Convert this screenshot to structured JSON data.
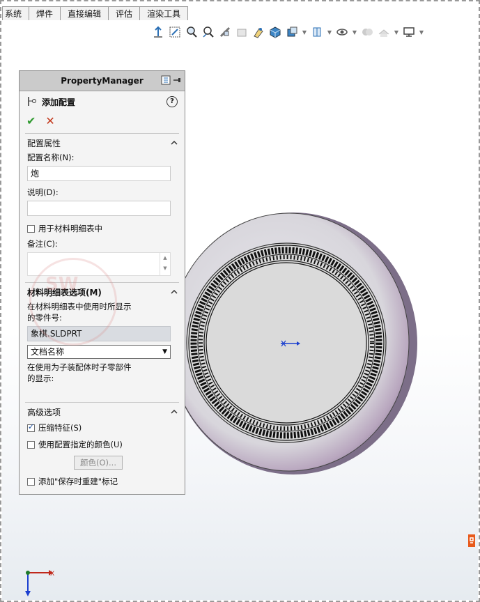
{
  "tabs": [
    "系统",
    "焊件",
    "直接编辑",
    "评估",
    "渲染工具"
  ],
  "hud_icons": [
    "view-orientation-icon",
    "zoom-to-fit-icon",
    "zoom-to-area-icon",
    "previous-view-icon",
    "section-view-icon",
    "dynamic-annotation-icon",
    "view-orientation-cube-icon",
    "display-style-icon",
    "hide-show-items-icon",
    "edit-appearance-icon",
    "apply-scene-icon",
    "view-settings-icon",
    "display-settings-icon"
  ],
  "pm": {
    "header": "PropertyManager",
    "title": "添加配置",
    "help": "?",
    "ok": "✔",
    "cancel": "✕",
    "config_props": {
      "heading": "配置属性",
      "name_label": "配置名称(N):",
      "name_value": "炮",
      "desc_label": "说明(D):",
      "desc_value": "",
      "use_in_bom": "用于材料明细表中",
      "use_in_bom_checked": false,
      "notes_label": "备注(C):"
    },
    "bom_options": {
      "heading": "材料明细表选项(M)",
      "part_number_label": "在材料明细表中使用时所显示的零件号:",
      "part_number_value": "象棋.SLDPRT",
      "select_value": "文档名称",
      "child_display_label": "在使用为子装配体时子零部件的显示:"
    },
    "advanced": {
      "heading": "高级选项",
      "suppress_features": "压缩特征(S)",
      "suppress_features_checked": true,
      "use_config_color": "使用配置指定的颜色(U)",
      "use_config_color_checked": false,
      "color_button": "颜色(O)...",
      "add_rebuild_mark": "添加\"保存时重建\"标记",
      "add_rebuild_mark_checked": false
    }
  },
  "watermark": {
    "text": "SW"
  },
  "axes": {
    "x_label": "X",
    "y_label": "Y"
  }
}
